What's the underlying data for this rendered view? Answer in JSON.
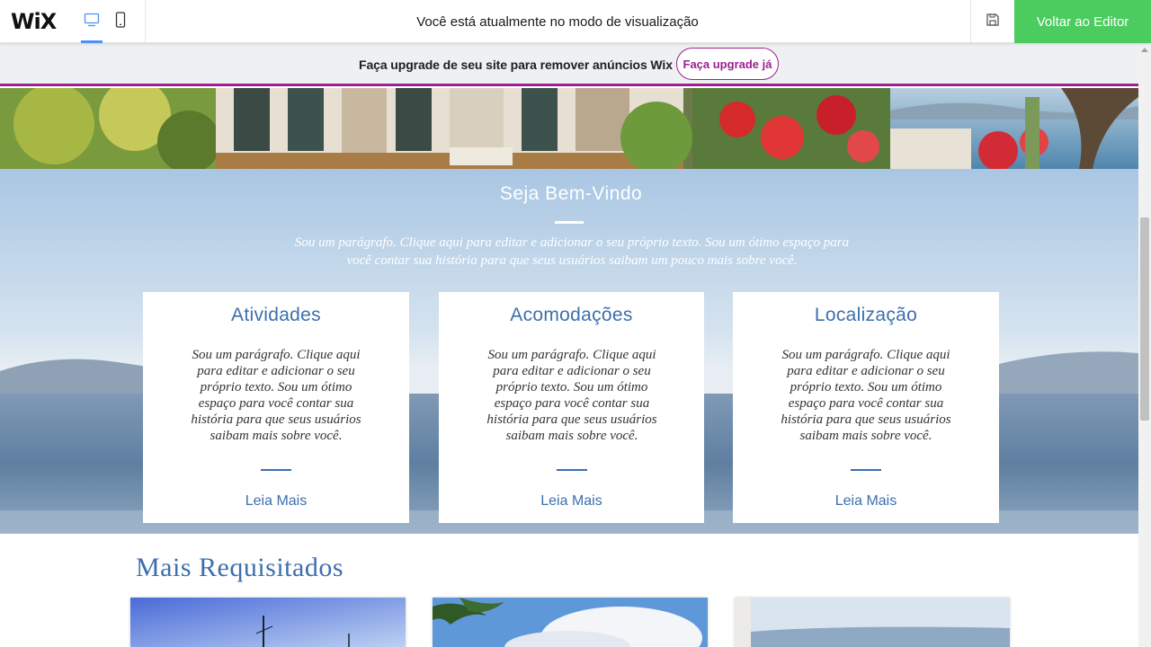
{
  "topbar": {
    "logo": "WiX",
    "mode_text": "Você está atualmente no modo de visualização",
    "back_button": "Voltar ao Editor"
  },
  "banner": {
    "text": "Faça upgrade de seu site para remover anúncios Wix",
    "button": "Faça upgrade já"
  },
  "welcome": {
    "title": "Seja Bem-Vindo",
    "paragraph": "Sou um parágrafo. Clique aqui para editar e adicionar o seu próprio texto. Sou um ótimo espaço para você contar sua história para que seus usuários saibam um pouco mais sobre você."
  },
  "cards": [
    {
      "title": "Atividades",
      "text": "Sou um parágrafo. Clique aqui para editar e adicionar o seu próprio texto. Sou um ótimo espaço para você contar sua história para que seus usuários saibam mais sobre você.",
      "link": "Leia Mais"
    },
    {
      "title": "Acomodações",
      "text": "Sou um parágrafo. Clique aqui para editar e adicionar o seu próprio texto. Sou um ótimo espaço para você contar sua história para que seus usuários saibam mais sobre você.",
      "link": "Leia Mais"
    },
    {
      "title": "Localização",
      "text": "Sou um parágrafo. Clique aqui para editar e adicionar o seu próprio texto. Sou um ótimo espaço para você contar sua história para que seus usuários saibam mais sobre você.",
      "link": "Leia Mais"
    }
  ],
  "section": {
    "title": "Mais Requisitados"
  },
  "colors": {
    "accent_green": "#4ccc5e",
    "banner_purple": "#9b2190",
    "link_blue": "#3c6fad",
    "device_active": "#4e8ff8"
  },
  "icons": [
    "desktop-icon",
    "mobile-icon",
    "save-icon",
    "scroll-up-arrow-icon"
  ]
}
